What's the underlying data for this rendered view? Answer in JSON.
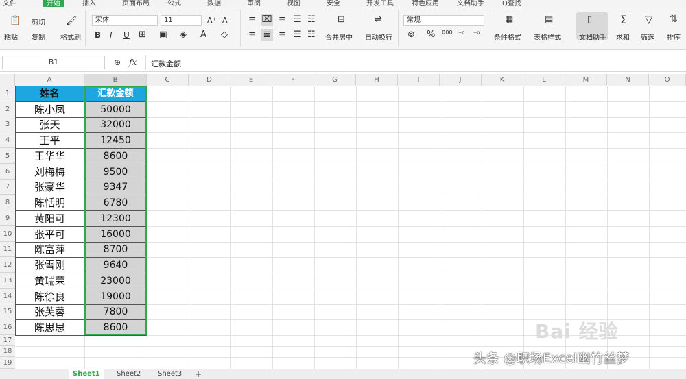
{
  "menu": {
    "tabs": [
      "文件",
      "开始",
      "插入",
      "页面布局",
      "公式",
      "数据",
      "审阅",
      "视图",
      "安全",
      "开发工具",
      "特色应用",
      "文档助手",
      "Q查找"
    ],
    "active": "开始"
  },
  "ribbon": {
    "paste": "粘贴",
    "cut": "剪切",
    "copy": "复制",
    "format_painter": "格式刷",
    "font_name": "宋体",
    "font_size": "11",
    "bold": "B",
    "italic": "I",
    "underline": "U",
    "merge_center": "合并居中",
    "wrap_text": "自动换行",
    "number_format": "常规",
    "cond_format": "条件格式",
    "table_style": "表格样式",
    "doc_assist": "文档助手",
    "sum": "求和",
    "filter": "筛选",
    "sort": "排序"
  },
  "formula": {
    "cell_ref": "B1",
    "fx": "fx",
    "content": "汇款金额"
  },
  "grid": {
    "columns": [
      "A",
      "B",
      "C",
      "D",
      "E",
      "F",
      "G",
      "H",
      "I",
      "J",
      "K",
      "L",
      "M",
      "N",
      "O"
    ],
    "rows": [
      "1",
      "2",
      "3",
      "4",
      "5",
      "6",
      "7",
      "8",
      "9",
      "10",
      "11",
      "12",
      "13",
      "14",
      "15",
      "16",
      "17",
      "18",
      "19"
    ]
  },
  "table": {
    "headers": [
      "姓名",
      "汇款金额"
    ],
    "rows": [
      [
        "陈小凤",
        "50000"
      ],
      [
        "张天",
        "32000"
      ],
      [
        "王平",
        "12450"
      ],
      [
        "王华华",
        "8600"
      ],
      [
        "刘梅梅",
        "9500"
      ],
      [
        "张豪华",
        "9347"
      ],
      [
        "陈恬明",
        "6780"
      ],
      [
        "黄阳可",
        "12300"
      ],
      [
        "张平可",
        "16000"
      ],
      [
        "陈富萍",
        "8700"
      ],
      [
        "张雪刚",
        "9640"
      ],
      [
        "黄瑞荣",
        "23000"
      ],
      [
        "陈徐良",
        "19000"
      ],
      [
        "张芙蓉",
        "7800"
      ],
      [
        "陈思思",
        "8600"
      ]
    ]
  },
  "sheets": {
    "tabs": [
      "Sheet1",
      "Sheet2",
      "Sheet3"
    ],
    "add": "+"
  },
  "watermark": "头条 @职场Excel幽竹丝梦",
  "baidu_mark": "Bai 经验",
  "colors": {
    "header_fill": "#1da6e0",
    "selection": "#2fa84f",
    "amount_fill": "#d4d4d4"
  }
}
